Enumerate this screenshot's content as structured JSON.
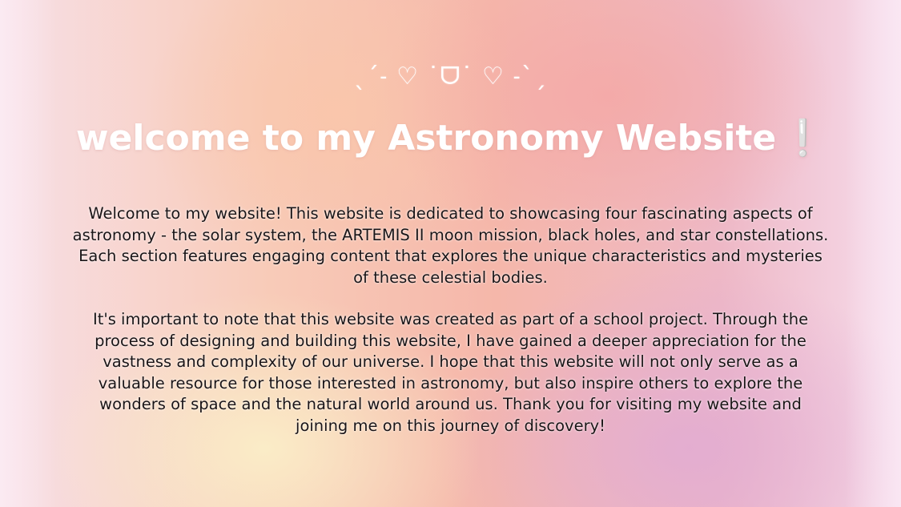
{
  "page": {
    "decoration": "ˎˊ˗ ♡ ˙ᗜ˙ ♡ ˗ˋˏ",
    "title": "welcome to my Astronomy Website",
    "title_mark": "❕",
    "paragraphs": [
      "Welcome to my website! This website is dedicated to showcasing four fascinating aspects of astronomy - the solar system, the ARTEMIS II moon mission, black holes, and star constellations. Each section features engaging content that explores the unique characteristics and mysteries of these celestial bodies.",
      "It's important to note that this website was created as part of a school project. Through the process of designing and building this website, I have gained a deeper appreciation for the vastness and complexity of our universe. I hope that this website will not only serve as a valuable resource for those interested in astronomy, but also inspire others to explore the wonders of space and the natural world around us. Thank you for visiting my website and joining me on this journey of discovery!"
    ]
  },
  "colors": {
    "title": "#ffffff",
    "body_text": "#1a1416",
    "gradient_peach": "#f8cbb8",
    "gradient_pink": "#f5b7aa",
    "gradient_lavender": "#e2acd2",
    "gradient_cream": "#faeec8"
  }
}
